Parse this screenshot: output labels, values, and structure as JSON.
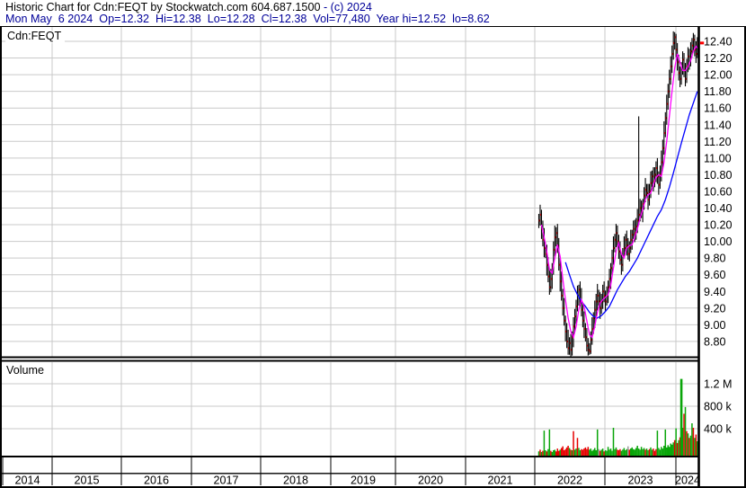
{
  "header": {
    "title_main": "Historic Chart for Cdn:FEQT by Stockwatch.com 604.687.1500",
    "title_copyright": " - (c) 2024",
    "quote_line": "Mon May  6 2024  Op=12.32  Hi=12.38  Lo=12.28  Cl=12.38  Vol=77,480  Year hi=12.52  lo=8.62",
    "quote": {
      "date": "Mon May 6 2024",
      "open": "12.32",
      "high": "12.38",
      "low": "12.28",
      "close": "12.38",
      "volume": "77,480",
      "year_high": "12.52",
      "year_low": "8.62"
    }
  },
  "colors": {
    "quote_text": "#000099",
    "grid": "#c9c9c9",
    "bar": "#000000",
    "close_tick": "#ff0000",
    "ma_short": "#ff00ff",
    "ma_long": "#0000ff",
    "vol_up": "#09a509",
    "vol_down": "#e60000",
    "vol_neutral": "#999999",
    "last_price_tick": "#ff0000"
  },
  "chart_data": {
    "type": "candlestick",
    "symbol_label": "Cdn:FEQT",
    "volume_pane_label": "Volume",
    "title": "Historic Chart for Cdn:FEQT by Stockwatch.com 604.687.1500 - (c) 2024",
    "price_axis_labels": [
      "12.40",
      "12.20",
      "12.00",
      "11.80",
      "11.60",
      "11.40",
      "11.20",
      "11.00",
      "10.80",
      "10.60",
      "10.40",
      "10.20",
      "10.00",
      "9.80",
      "9.60",
      "9.40",
      "9.20",
      "9.00",
      "8.80"
    ],
    "volume_axis_labels": [
      "1.2 M",
      "800 k",
      "400 k"
    ],
    "volume_axis_values_k": [
      1200,
      800,
      400
    ],
    "year_labels": [
      "2014",
      "2015",
      "2016",
      "2017",
      "2018",
      "2019",
      "2020",
      "2021",
      "2022",
      "2023",
      "2024"
    ],
    "data_start": "2022-01",
    "price_ylim": [
      8.62,
      12.52
    ],
    "grid_step": 0.2,
    "bars_ohlc_weekly": [
      [
        10.33,
        10.16,
        10.25
      ],
      [
        10.44,
        10.19,
        10.32
      ],
      [
        10.38,
        10.03,
        10.15
      ],
      [
        10.25,
        9.94,
        10.02
      ],
      [
        10.16,
        9.81,
        9.92
      ],
      [
        9.99,
        9.8,
        9.85
      ],
      [
        9.96,
        9.59,
        9.72
      ],
      [
        9.81,
        9.51,
        9.58
      ],
      [
        9.66,
        9.36,
        9.45
      ],
      [
        9.67,
        9.39,
        9.55
      ],
      [
        9.74,
        9.43,
        9.68
      ],
      [
        10.0,
        9.6,
        9.9
      ],
      [
        10.19,
        9.82,
        10.05
      ],
      [
        10.17,
        9.94,
        10.1
      ],
      [
        10.21,
        9.86,
        9.95
      ],
      [
        10.04,
        9.65,
        9.72
      ],
      [
        9.8,
        9.4,
        9.52
      ],
      [
        9.64,
        9.29,
        9.35
      ],
      [
        9.43,
        9.11,
        9.2
      ],
      [
        9.32,
        8.99,
        9.05
      ],
      [
        9.11,
        8.8,
        8.92
      ],
      [
        9.02,
        8.72,
        8.8
      ],
      [
        8.94,
        8.64,
        8.72
      ],
      [
        8.85,
        8.64,
        8.78
      ],
      [
        8.89,
        8.62,
        8.7
      ],
      [
        8.92,
        8.63,
        8.85
      ],
      [
        9.09,
        8.73,
        8.98
      ],
      [
        9.19,
        8.91,
        9.1
      ],
      [
        9.3,
        9.01,
        9.22
      ],
      [
        9.47,
        9.16,
        9.35
      ],
      [
        9.48,
        9.23,
        9.42
      ],
      [
        9.52,
        9.22,
        9.3
      ],
      [
        9.44,
        9.1,
        9.18
      ],
      [
        9.25,
        8.97,
        9.05
      ],
      [
        9.16,
        8.84,
        8.95
      ],
      [
        9.02,
        8.8,
        8.85
      ],
      [
        8.96,
        8.68,
        8.75
      ],
      [
        8.84,
        8.63,
        8.7
      ],
      [
        8.78,
        8.64,
        8.68
      ],
      [
        8.92,
        8.65,
        8.82
      ],
      [
        9.09,
        8.76,
        8.95
      ],
      [
        9.15,
        8.89,
        9.08
      ],
      [
        9.29,
        8.96,
        9.18
      ],
      [
        9.37,
        9.1,
        9.28
      ],
      [
        9.49,
        9.17,
        9.35
      ],
      [
        9.42,
        9.23,
        9.28
      ],
      [
        9.39,
        9.07,
        9.2
      ],
      [
        9.37,
        9.13,
        9.28
      ],
      [
        9.48,
        9.19,
        9.4
      ],
      [
        9.52,
        9.27,
        9.35
      ],
      [
        9.41,
        9.17,
        9.28
      ],
      [
        9.46,
        9.23,
        9.35
      ],
      [
        9.53,
        9.26,
        9.45
      ],
      [
        9.67,
        9.39,
        9.55
      ],
      [
        9.74,
        9.43,
        9.68
      ],
      [
        9.9,
        9.6,
        9.8
      ],
      [
        10.06,
        9.72,
        9.92
      ],
      [
        10.09,
        9.87,
        10.02
      ],
      [
        10.21,
        9.93,
        10.1
      ],
      [
        10.19,
        9.93,
        10.0
      ],
      [
        10.08,
        9.79,
        9.88
      ],
      [
        10.0,
        9.72,
        9.78
      ],
      [
        9.84,
        9.6,
        9.72
      ],
      [
        9.92,
        9.64,
        9.82
      ],
      [
        10.06,
        9.81,
        9.92
      ],
      [
        10.09,
        9.87,
        10.02
      ],
      [
        10.13,
        9.83,
        9.95
      ],
      [
        10.04,
        9.78,
        9.85
      ],
      [
        10.0,
        9.76,
        9.92
      ],
      [
        10.14,
        9.86,
        10.02
      ],
      [
        10.14,
        9.9,
        10.08
      ],
      [
        10.25,
        10.03,
        10.15
      ],
      [
        10.26,
        9.99,
        10.1
      ],
      [
        10.28,
        10.02,
        10.18
      ],
      [
        10.39,
        10.1,
        10.25
      ],
      [
        11.5,
        10.2,
        10.32
      ],
      [
        10.51,
        10.24,
        10.4
      ],
      [
        10.49,
        10.28,
        10.35
      ],
      [
        10.51,
        10.23,
        10.45
      ],
      [
        10.65,
        10.38,
        10.55
      ],
      [
        10.76,
        10.47,
        10.62
      ],
      [
        10.69,
        10.53,
        10.58
      ],
      [
        10.69,
        10.38,
        10.5
      ],
      [
        10.69,
        10.43,
        10.6
      ],
      [
        10.84,
        10.52,
        10.7
      ],
      [
        10.85,
        10.65,
        10.78
      ],
      [
        10.89,
        10.6,
        10.72
      ],
      [
        10.89,
        10.65,
        10.8
      ],
      [
        10.96,
        10.71,
        10.88
      ],
      [
        11.0,
        10.69,
        10.78
      ],
      [
        10.84,
        10.56,
        10.68
      ],
      [
        10.91,
        10.63,
        10.8
      ],
      [
        11.09,
        10.72,
        10.95
      ],
      [
        11.22,
        10.87,
        11.12
      ],
      [
        11.44,
        11.04,
        11.3
      ],
      [
        11.55,
        11.25,
        11.48
      ],
      [
        11.76,
        11.4,
        11.65
      ],
      [
        11.89,
        11.58,
        11.8
      ],
      [
        12.06,
        11.72,
        11.95
      ],
      [
        12.22,
        11.88,
        12.1
      ],
      [
        12.35,
        12.02,
        12.25
      ],
      [
        12.52,
        12.18,
        12.38
      ],
      [
        12.51,
        12.3,
        12.45
      ],
      [
        12.49,
        12.21,
        12.3
      ],
      [
        12.38,
        12.05,
        12.15
      ],
      [
        12.24,
        11.93,
        12.02
      ],
      [
        12.1,
        11.85,
        11.95
      ],
      [
        12.15,
        11.88,
        12.08
      ],
      [
        12.28,
        12.0,
        12.18
      ],
      [
        12.26,
        11.97,
        12.05
      ],
      [
        12.14,
        11.86,
        11.95
      ],
      [
        12.19,
        11.9,
        12.1
      ],
      [
        12.33,
        12.03,
        12.22
      ],
      [
        12.31,
        12.06,
        12.15
      ],
      [
        12.39,
        12.1,
        12.28
      ],
      [
        12.44,
        12.21,
        12.35
      ],
      [
        12.5,
        12.28,
        12.42
      ],
      [
        12.48,
        12.22,
        12.3
      ],
      [
        12.4,
        12.14,
        12.25
      ],
      [
        12.45,
        12.2,
        12.38
      ]
    ],
    "volume_weekly_k": [
      [
        60,
        "g"
      ],
      [
        90,
        "r"
      ],
      [
        50,
        "g"
      ],
      [
        70,
        "r"
      ],
      [
        430,
        "g"
      ],
      [
        80,
        "g"
      ],
      [
        60,
        "r"
      ],
      [
        100,
        "g"
      ],
      [
        450,
        "g"
      ],
      [
        70,
        "r"
      ],
      [
        50,
        "g"
      ],
      [
        80,
        "g"
      ],
      [
        90,
        "g"
      ],
      [
        60,
        "r"
      ],
      [
        110,
        "r"
      ],
      [
        70,
        "r"
      ],
      [
        90,
        "g"
      ],
      [
        120,
        "r"
      ],
      [
        150,
        "r"
      ],
      [
        80,
        "r"
      ],
      [
        100,
        "r"
      ],
      [
        130,
        "r"
      ],
      [
        160,
        "r"
      ],
      [
        120,
        "g"
      ],
      [
        90,
        "r"
      ],
      [
        80,
        "g"
      ],
      [
        420,
        "r"
      ],
      [
        90,
        "g"
      ],
      [
        110,
        "g"
      ],
      [
        300,
        "r"
      ],
      [
        120,
        "g"
      ],
      [
        80,
        "g"
      ],
      [
        100,
        "r"
      ],
      [
        90,
        "r"
      ],
      [
        110,
        "r"
      ],
      [
        130,
        "r"
      ],
      [
        100,
        "r"
      ],
      [
        140,
        "r"
      ],
      [
        90,
        "g"
      ],
      [
        110,
        "g"
      ],
      [
        70,
        "g"
      ],
      [
        90,
        "g"
      ],
      [
        120,
        "g"
      ],
      [
        80,
        "g"
      ],
      [
        450,
        "g"
      ],
      [
        100,
        "y"
      ],
      [
        70,
        "r"
      ],
      [
        90,
        "g"
      ],
      [
        110,
        "g"
      ],
      [
        60,
        "r"
      ],
      [
        80,
        "g"
      ],
      [
        70,
        "g"
      ],
      [
        140,
        "g"
      ],
      [
        90,
        "g"
      ],
      [
        110,
        "g"
      ],
      [
        70,
        "g"
      ],
      [
        480,
        "g"
      ],
      [
        100,
        "g"
      ],
      [
        130,
        "g"
      ],
      [
        90,
        "r"
      ],
      [
        80,
        "r"
      ],
      [
        100,
        "r"
      ],
      [
        70,
        "g"
      ],
      [
        90,
        "g"
      ],
      [
        120,
        "g"
      ],
      [
        80,
        "g"
      ],
      [
        100,
        "g"
      ],
      [
        150,
        "y"
      ],
      [
        90,
        "r"
      ],
      [
        110,
        "g"
      ],
      [
        130,
        "g"
      ],
      [
        100,
        "g"
      ],
      [
        90,
        "g"
      ],
      [
        120,
        "g"
      ],
      [
        160,
        "g"
      ],
      [
        110,
        "g"
      ],
      [
        90,
        "g"
      ],
      [
        140,
        "g"
      ],
      [
        100,
        "g"
      ],
      [
        120,
        "g"
      ],
      [
        90,
        "r"
      ],
      [
        110,
        "g"
      ],
      [
        80,
        "g"
      ],
      [
        100,
        "r"
      ],
      [
        130,
        "g"
      ],
      [
        90,
        "g"
      ],
      [
        110,
        "r"
      ],
      [
        70,
        "r"
      ],
      [
        100,
        "r"
      ],
      [
        430,
        "g"
      ],
      [
        120,
        "g"
      ],
      [
        90,
        "g"
      ],
      [
        140,
        "g"
      ],
      [
        110,
        "g"
      ],
      [
        160,
        "g"
      ],
      [
        450,
        "g"
      ],
      [
        130,
        "g"
      ],
      [
        170,
        "g"
      ],
      [
        140,
        "g"
      ],
      [
        200,
        "g"
      ],
      [
        180,
        "g"
      ],
      [
        220,
        "g"
      ],
      [
        260,
        "r"
      ],
      [
        470,
        "g"
      ],
      [
        210,
        "r"
      ],
      [
        260,
        "g"
      ],
      [
        310,
        "r"
      ],
      [
        1350,
        "g"
      ],
      [
        480,
        "g"
      ],
      [
        730,
        "r"
      ],
      [
        850,
        "g"
      ],
      [
        420,
        "r"
      ],
      [
        380,
        "g"
      ],
      [
        300,
        "r"
      ],
      [
        340,
        "g"
      ],
      [
        560,
        "g"
      ],
      [
        480,
        "r"
      ],
      [
        300,
        "g"
      ],
      [
        360,
        "r"
      ],
      [
        240,
        "g"
      ]
    ],
    "ma_short": {
      "name": "short moving average",
      "color": "#ff00ff",
      "points": [
        [
          2,
          10.2
        ],
        [
          4,
          10.05
        ],
        [
          6,
          9.88
        ],
        [
          8,
          9.66
        ],
        [
          10,
          9.62
        ],
        [
          12,
          9.8
        ],
        [
          14,
          9.96
        ],
        [
          16,
          9.82
        ],
        [
          18,
          9.55
        ],
        [
          20,
          9.3
        ],
        [
          22,
          9.08
        ],
        [
          24,
          8.92
        ],
        [
          26,
          8.85
        ],
        [
          28,
          8.98
        ],
        [
          30,
          9.18
        ],
        [
          32,
          9.3
        ],
        [
          34,
          9.22
        ],
        [
          36,
          9.05
        ],
        [
          38,
          8.88
        ],
        [
          40,
          8.85
        ],
        [
          42,
          8.98
        ],
        [
          44,
          9.15
        ],
        [
          46,
          9.26
        ],
        [
          48,
          9.3
        ],
        [
          50,
          9.33
        ],
        [
          52,
          9.36
        ],
        [
          54,
          9.48
        ],
        [
          56,
          9.68
        ],
        [
          58,
          9.88
        ],
        [
          60,
          9.98
        ],
        [
          62,
          9.85
        ],
        [
          64,
          9.8
        ],
        [
          66,
          9.92
        ],
        [
          68,
          9.95
        ],
        [
          70,
          9.96
        ],
        [
          72,
          10.05
        ],
        [
          74,
          10.15
        ],
        [
          76,
          10.28
        ],
        [
          78,
          10.38
        ],
        [
          80,
          10.5
        ],
        [
          82,
          10.56
        ],
        [
          84,
          10.58
        ],
        [
          86,
          10.68
        ],
        [
          88,
          10.77
        ],
        [
          90,
          10.8
        ],
        [
          92,
          10.78
        ],
        [
          94,
          10.95
        ],
        [
          96,
          11.2
        ],
        [
          98,
          11.5
        ],
        [
          100,
          11.8
        ],
        [
          102,
          12.08
        ],
        [
          104,
          12.25
        ],
        [
          106,
          12.15
        ],
        [
          108,
          12.05
        ],
        [
          110,
          12.05
        ],
        [
          112,
          12.1
        ],
        [
          114,
          12.17
        ],
        [
          116,
          12.28
        ],
        [
          118,
          12.34
        ],
        [
          119,
          12.32
        ]
      ]
    },
    "ma_long": {
      "name": "long moving average",
      "color": "#0000ff",
      "points": [
        [
          20,
          9.75
        ],
        [
          23,
          9.6
        ],
        [
          26,
          9.46
        ],
        [
          29,
          9.36
        ],
        [
          32,
          9.28
        ],
        [
          35,
          9.22
        ],
        [
          38,
          9.15
        ],
        [
          41,
          9.1
        ],
        [
          44,
          9.08
        ],
        [
          47,
          9.11
        ],
        [
          50,
          9.16
        ],
        [
          53,
          9.22
        ],
        [
          56,
          9.32
        ],
        [
          59,
          9.42
        ],
        [
          62,
          9.5
        ],
        [
          65,
          9.58
        ],
        [
          68,
          9.64
        ],
        [
          71,
          9.72
        ],
        [
          74,
          9.8
        ],
        [
          77,
          9.9
        ],
        [
          80,
          10.0
        ],
        [
          83,
          10.1
        ],
        [
          86,
          10.2
        ],
        [
          89,
          10.3
        ],
        [
          92,
          10.38
        ],
        [
          95,
          10.5
        ],
        [
          98,
          10.65
        ],
        [
          101,
          10.82
        ],
        [
          104,
          11.0
        ],
        [
          107,
          11.18
        ],
        [
          110,
          11.35
        ],
        [
          113,
          11.52
        ],
        [
          116,
          11.66
        ],
        [
          119,
          11.8
        ]
      ]
    }
  }
}
